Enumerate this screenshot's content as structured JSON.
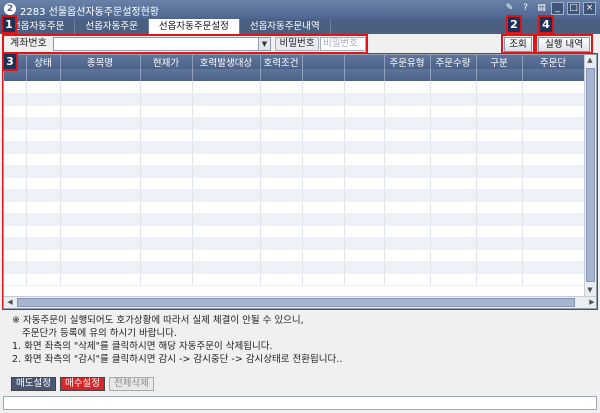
{
  "window": {
    "title": "2283 선물옵션자동주문설정현황",
    "icons": [
      "pin-icon",
      "help-icon",
      "menu-icon",
      "minimize-icon",
      "maximize-icon",
      "close-icon"
    ],
    "icon_glyphs": [
      "✎",
      "?",
      "▤",
      "_",
      "□",
      "×"
    ]
  },
  "tabs": [
    "선옵자동주문",
    "선옵자동주문",
    "선옵자동주문설정",
    "선옵자동주문내역"
  ],
  "active_tab": 2,
  "markers": [
    "1",
    "2",
    "3",
    "4"
  ],
  "toolbar": {
    "account_label": "계좌번호",
    "account_value": "",
    "password_label": "비밀번호",
    "password_placeholder": "비밀번호",
    "query_button": "조회",
    "history_button": "실행 내역"
  },
  "grid": {
    "columns": [
      "",
      "상태",
      "종목명",
      "현재가",
      "호력발생대상",
      "호력조건",
      "",
      "",
      "주문유형",
      "주문수량",
      "구분",
      "주문단"
    ],
    "row_count": 17
  },
  "notes": [
    "※ 자동주문이 실행되어도 호가상황에 따라서 실제 체결이 안될 수 있으니,",
    "   주문단가 등록에 유의 하시기 바랍니다.",
    "1. 화면 좌측의 \"삭제\"를 클릭하시면 해당 자동주문이 삭제됩니다.",
    "2. 화면 좌측의 \"감시\"를 클릭하시면 감시 -> 감시중단 -> 감시상태로 전환됩니다.."
  ],
  "actions": {
    "sell_setting": "매도설정",
    "buy_setting": "매수설정",
    "delete_all": "전체삭제"
  },
  "colors": {
    "accent_red": "#e01515",
    "header_blue": "#4e668f",
    "buy_red": "#d6262a"
  }
}
